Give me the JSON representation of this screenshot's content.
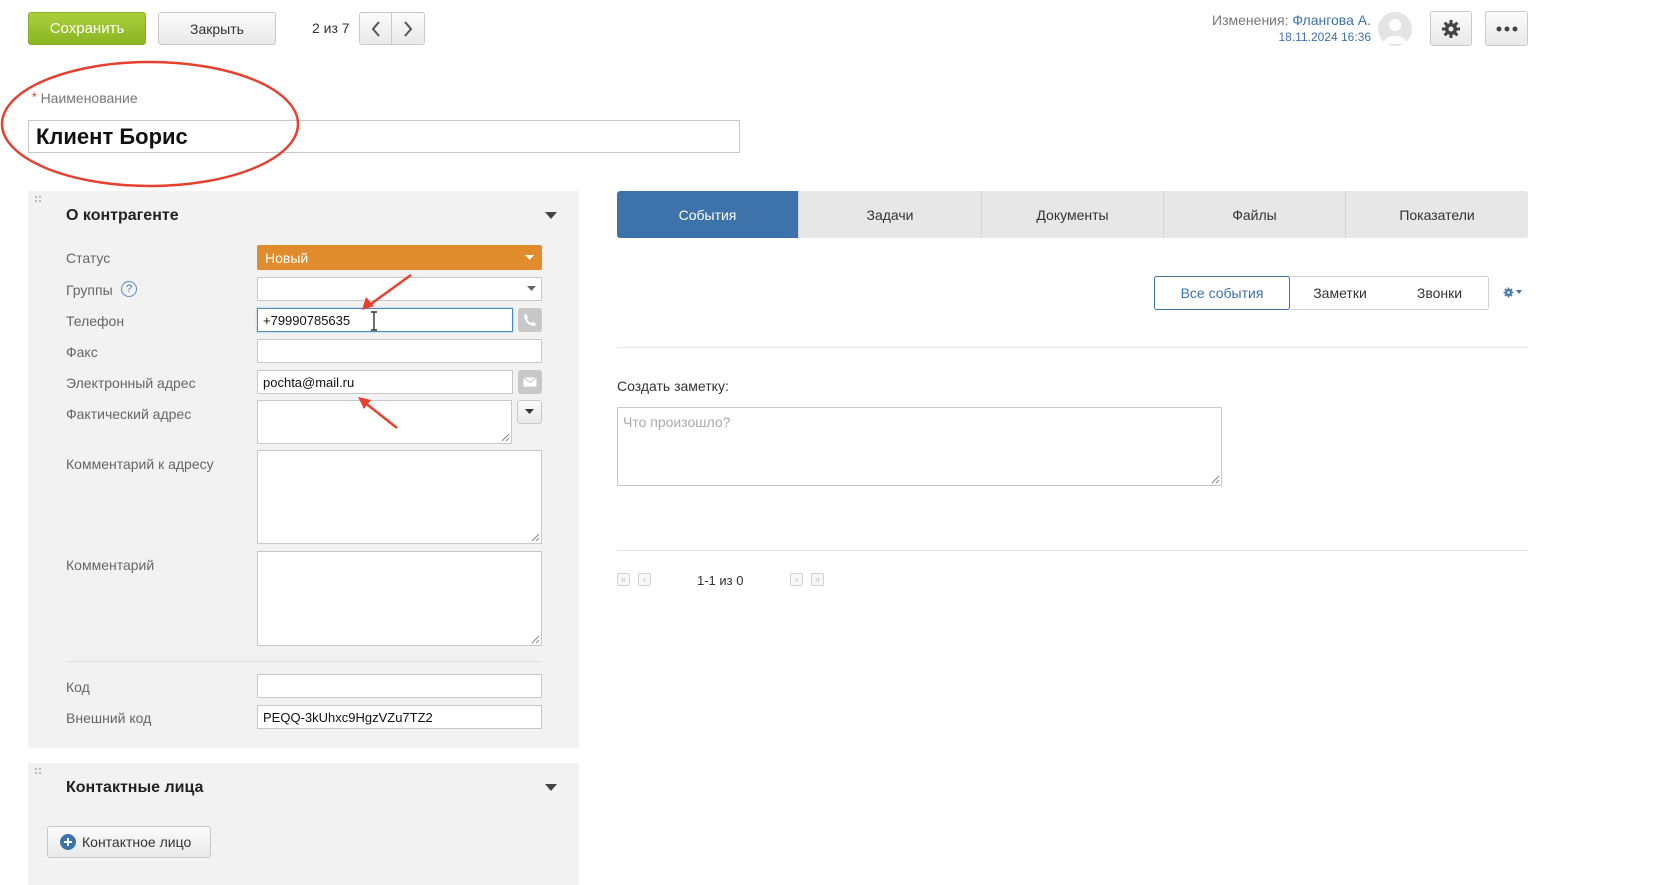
{
  "toolbar": {
    "save_label": "Сохранить",
    "close_label": "Закрыть",
    "counter": "2 из 7"
  },
  "header": {
    "changes_label": "Изменения:",
    "changed_by": "Флангова А.",
    "changed_at": "18.11.2024 16:36"
  },
  "name_field": {
    "label": "Наименование",
    "required_mark": "*",
    "value": "Клиент Борис"
  },
  "about": {
    "title": "О контрагенте",
    "status_label": "Статус",
    "status_value": "Новый",
    "groups_label": "Группы",
    "groups_help": "?",
    "phone_label": "Телефон",
    "phone_value": "+79990785635",
    "fax_label": "Факс",
    "email_label": "Электронный адрес",
    "email_value": "pochta@mail.ru",
    "address_label": "Фактический адрес",
    "address_comment_label": "Комментарий к адресу",
    "comment_label": "Комментарий",
    "code_label": "Код",
    "external_code_label": "Внешний код",
    "external_code_value": "PEQQ-3kUhxc9HgzVZu7TZ2"
  },
  "contacts": {
    "title": "Контактные лица",
    "add_button": "Контактное лицо"
  },
  "tabs": [
    "События",
    "Задачи",
    "Документы",
    "Файлы",
    "Показатели"
  ],
  "event_filters": [
    "Все события",
    "Заметки",
    "Звонки"
  ],
  "note": {
    "label": "Создать заметку:",
    "placeholder": "Что произошло?"
  },
  "pagination": {
    "text": "1-1 из 0"
  },
  "colors": {
    "accent_blue": "#3e72aa",
    "save_green": "#9bc42f",
    "status_orange": "#e08b2c",
    "annotation_red": "#e5412f"
  }
}
